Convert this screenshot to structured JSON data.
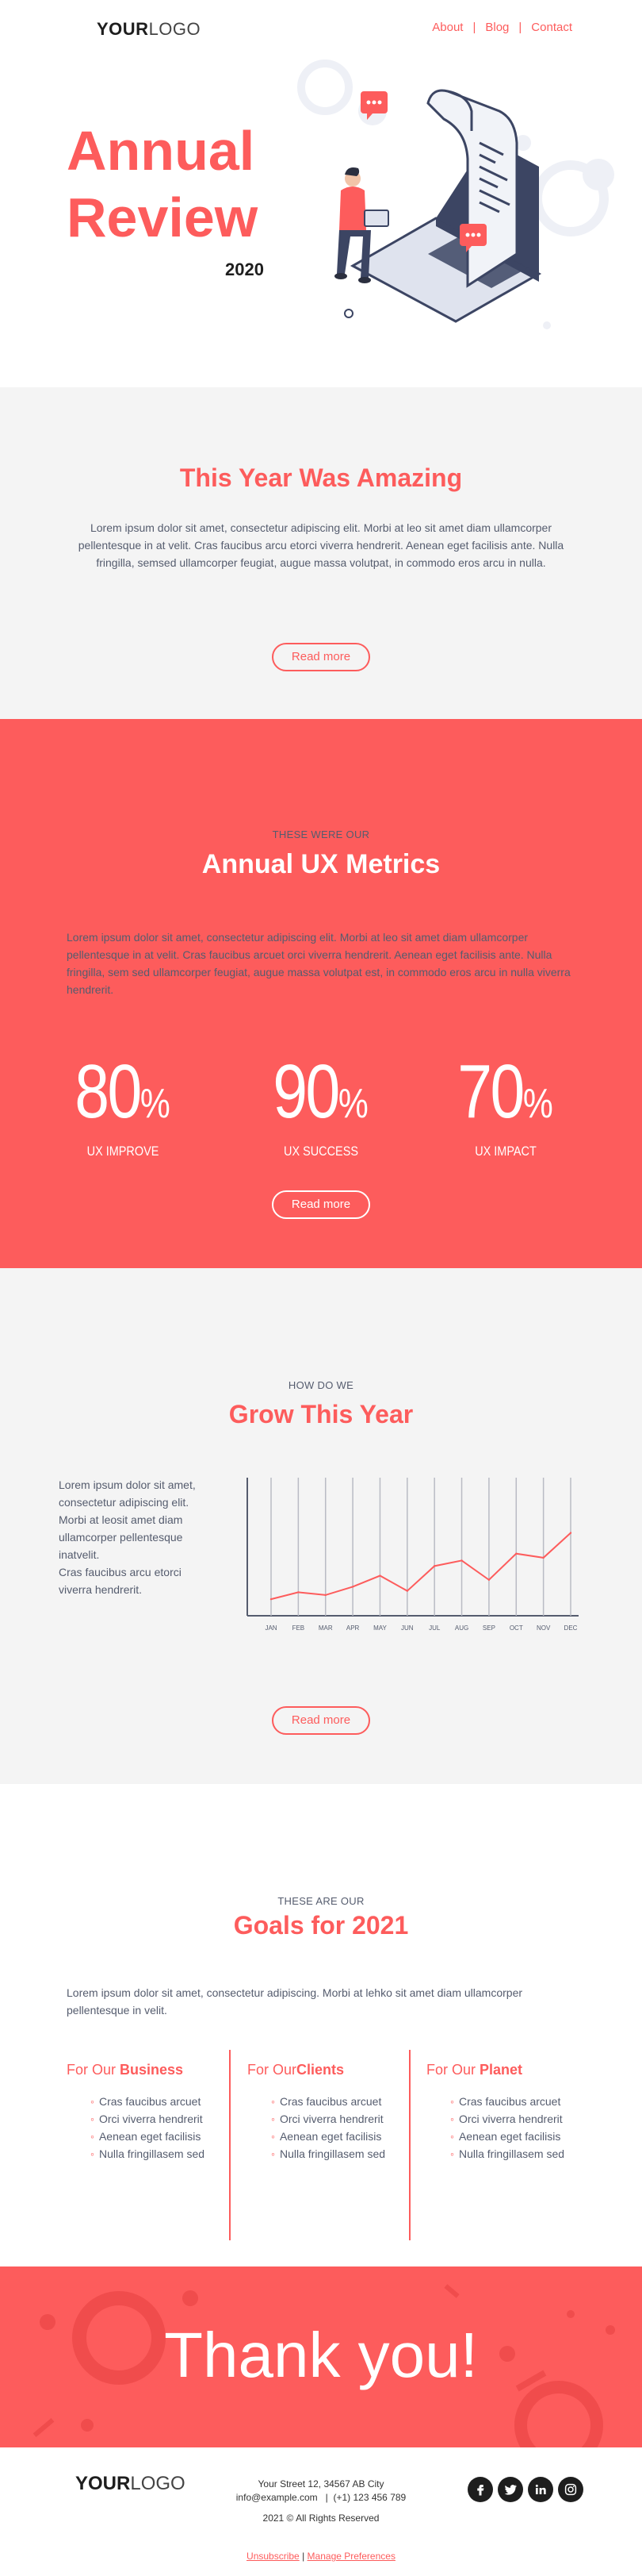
{
  "header": {
    "logo_bold": "YOUR",
    "logo_light": "LOGO",
    "nav": [
      "About",
      "Blog",
      "Contact"
    ],
    "nav_sep": "|"
  },
  "hero": {
    "title_line1": "Annual",
    "title_line2": "Review",
    "year": "2020"
  },
  "amazing": {
    "title": "This Year Was Amazing",
    "text": "Lorem ipsum dolor sit amet, consectetur adipiscing elit. Morbi at leo sit amet diam ullamcorper pellentesque in at velit. Cras faucibus arcu etorci viverra hendrerit. Aenean eget facilisis ante. Nulla fringilla, semsed ullamcorper feugiat, augue massa volutpat, in commodo eros arcu in nulla.",
    "button": "Read more"
  },
  "metrics": {
    "eyebrow": "THESE WERE OUR",
    "title": "Annual UX Metrics",
    "text": "Lorem ipsum dolor sit amet, consectetur adipiscing elit. Morbi at leo sit amet diam ullamcorper pellentesque in at velit. Cras faucibus arcuet orci viverra hendrerit. Aenean eget facilisis ante. Nulla fringilla, sem sed ullamcorper feugiat, augue massa volutpat est, in commodo eros arcu in nulla viverra hendrerit.",
    "items": [
      {
        "value": "80",
        "unit": "%",
        "label": "UX IMPROVE"
      },
      {
        "value": "90",
        "unit": "%",
        "label": "UX SUCCESS"
      },
      {
        "value": "70",
        "unit": "%",
        "label": "UX IMPACT"
      }
    ],
    "button": "Read more"
  },
  "grow": {
    "eyebrow": "HOW DO WE",
    "title": "Grow This Year",
    "text_lines": [
      "Lorem ipsum dolor sit amet,",
      "consectetur adipiscing elit.",
      "Morbi at leosit amet diam",
      "ullamcorper pellentesque",
      "inatvelit.",
      "Cras faucibus arcu etorci",
      "viverra hendrerit."
    ],
    "button": "Read more"
  },
  "chart_data": {
    "type": "line",
    "categories": [
      "JAN",
      "FEB",
      "MAR",
      "APR",
      "MAY",
      "JUN",
      "JUL",
      "AUG",
      "SEP",
      "OCT",
      "NOV",
      "DEC"
    ],
    "series": [
      {
        "values": [
          12,
          17,
          15,
          21,
          29,
          18,
          36,
          40,
          26,
          45,
          42,
          60
        ]
      }
    ],
    "ylim": [
      0,
      100
    ],
    "grid": "vertical",
    "line_color": "#fd5c5c",
    "grid_color": "#b9bbc4"
  },
  "goals": {
    "eyebrow": "THESE ARE OUR",
    "title": "Goals for 2021",
    "text": "Lorem ipsum dolor sit amet, consectetur adipiscing. Morbi at lehko sit amet diam ullamcorper pellentesque in velit.",
    "columns": [
      {
        "prefix": "For Our ",
        "bold": "Business",
        "items": [
          "Cras faucibus arcuet",
          "Orci viverra hendrerit",
          "Aenean eget facilisis",
          "Nulla fringillasem sed"
        ]
      },
      {
        "prefix": "For Our",
        "bold": "Clients",
        "items": [
          "Cras faucibus arcuet",
          "Orci viverra hendrerit",
          "Aenean eget facilisis",
          "Nulla fringillasem sed"
        ]
      },
      {
        "prefix": "For Our ",
        "bold": "Planet",
        "items": [
          "Cras faucibus arcuet",
          "Orci viverra hendrerit",
          "Aenean eget facilisis",
          "Nulla fringillasem sed"
        ]
      }
    ]
  },
  "thanks": {
    "text": "Thank you!"
  },
  "footer": {
    "logo_bold": "YOUR",
    "logo_light": "LOGO",
    "address": "Your Street 12, 34567 AB City",
    "email": "info@example.com",
    "phone": "(+1) 123 456 789",
    "contact_sep": "|",
    "copyright": "2021 © All Rights Reserved",
    "unsubscribe": "Unsubscribe",
    "manage": "Manage Preferences",
    "links_sep": "|",
    "social": [
      "facebook-icon",
      "twitter-icon",
      "linkedin-icon",
      "instagram-icon"
    ]
  },
  "colors": {
    "brand": "#fd5c5c",
    "light_bg": "#f4f4f4",
    "text": "#555c6e",
    "dark": "#1e1e1e"
  }
}
